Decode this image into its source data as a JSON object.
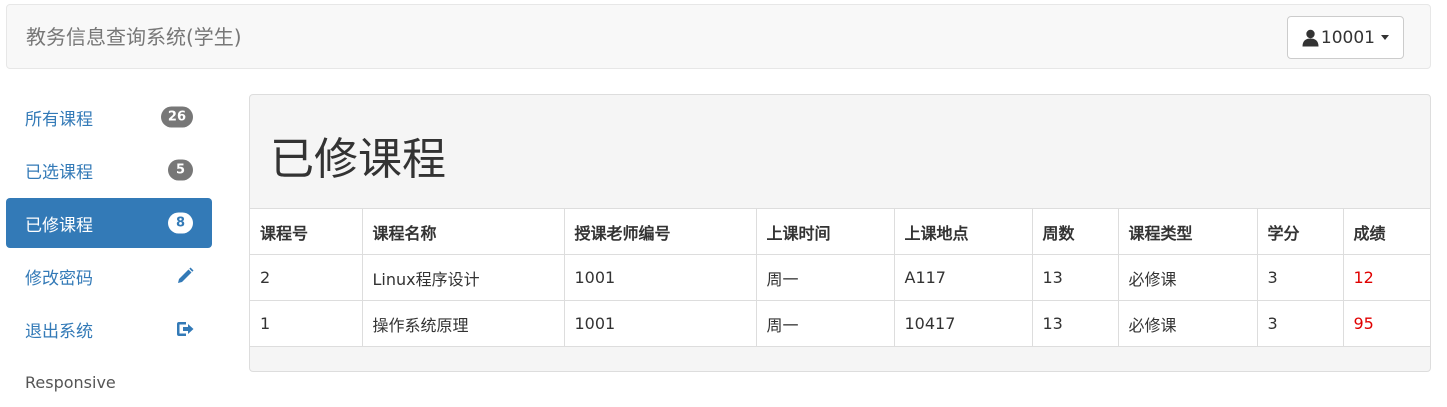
{
  "header": {
    "brand": "教务信息查询系统(学生)",
    "user_label": "10001"
  },
  "sidebar": {
    "items": [
      {
        "label": "所有课程",
        "badge": "26",
        "icon": null,
        "active": false
      },
      {
        "label": "已选课程",
        "badge": "5",
        "icon": null,
        "active": false
      },
      {
        "label": "已修课程",
        "badge": "8",
        "icon": null,
        "active": true
      },
      {
        "label": "修改密码",
        "badge": null,
        "icon": "pencil-icon",
        "active": false
      },
      {
        "label": "退出系统",
        "badge": null,
        "icon": "logout-icon",
        "active": false
      }
    ],
    "footer": "Responsive"
  },
  "main": {
    "title": "已修课程",
    "table": {
      "headers": [
        "课程号",
        "课程名称",
        "授课老师编号",
        "上课时间",
        "上课地点",
        "周数",
        "课程类型",
        "学分",
        "成绩"
      ],
      "rows": [
        [
          "2",
          "Linux程序设计",
          "1001",
          "周一",
          "A117",
          "13",
          "必修课",
          "3",
          "12"
        ],
        [
          "1",
          "操作系统原理",
          "1001",
          "周一",
          "10417",
          "13",
          "必修课",
          "3",
          "95"
        ]
      ]
    }
  },
  "colors": {
    "accent": "#337ab7",
    "score": "#e00000",
    "badge": "#777777"
  }
}
